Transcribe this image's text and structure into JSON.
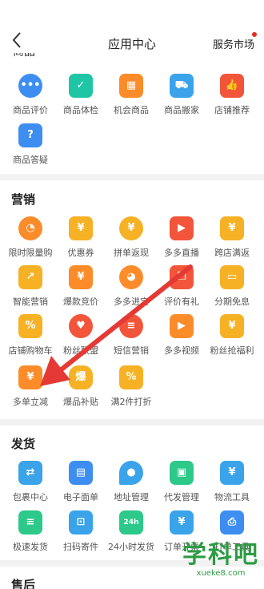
{
  "header": {
    "back_icon": "chevron-left-icon",
    "title": "应用中心",
    "market_label": "服务市场",
    "partial_title": "商品"
  },
  "colors": {
    "accent": "#e02e24",
    "arrow": "#e53935",
    "watermark": "#2d9b44"
  },
  "sections": {
    "goods": {
      "items": [
        {
          "label": "商品评价",
          "icon": "chat-bubble-icon"
        },
        {
          "label": "商品体检",
          "icon": "shopping-bag-check-icon"
        },
        {
          "label": "机会商品",
          "icon": "grid-search-icon"
        },
        {
          "label": "商品搬家",
          "icon": "truck-icon"
        },
        {
          "label": "店铺推荐",
          "icon": "thumbs-up-icon"
        },
        {
          "label": "商品答疑",
          "icon": "question-chat-icon"
        }
      ]
    },
    "marketing": {
      "title": "营销",
      "items": [
        {
          "label": "限时限量购",
          "icon": "clock-icon"
        },
        {
          "label": "优惠券",
          "icon": "coupon-icon"
        },
        {
          "label": "拼单返现",
          "icon": "coin-cycle-icon"
        },
        {
          "label": "多多直播",
          "icon": "video-play-icon"
        },
        {
          "label": "跨店满返",
          "icon": "house-yuan-icon"
        },
        {
          "label": "智能营销",
          "icon": "trend-chart-icon"
        },
        {
          "label": "爆款竞价",
          "icon": "gift-yuan-icon"
        },
        {
          "label": "多多进宝",
          "icon": "pig-icon"
        },
        {
          "label": "评价有礼",
          "icon": "gift-box-icon"
        },
        {
          "label": "分期免息",
          "icon": "credit-card-icon"
        },
        {
          "label": "店铺购物车",
          "icon": "cart-percent-icon"
        },
        {
          "label": "粉丝联盟",
          "icon": "heart-icon"
        },
        {
          "label": "短信营销",
          "icon": "message-icon"
        },
        {
          "label": "多多视频",
          "icon": "tv-icon"
        },
        {
          "label": "粉丝抢福利",
          "icon": "red-envelope-icon"
        },
        {
          "label": "多单立减",
          "icon": "stacked-discount-icon"
        },
        {
          "label": "爆品补贴",
          "icon": "money-bag-icon"
        },
        {
          "label": "满2件打折",
          "icon": "bag-percent-icon"
        }
      ]
    },
    "shipping": {
      "title": "发货",
      "items": [
        {
          "label": "包裹中心",
          "icon": "package-swap-icon"
        },
        {
          "label": "电子面单",
          "icon": "waybill-icon"
        },
        {
          "label": "地址管理",
          "icon": "location-pin-icon"
        },
        {
          "label": "代发管理",
          "icon": "box-icon"
        },
        {
          "label": "物流工具",
          "icon": "truck-yuan-icon"
        },
        {
          "label": "极速发货",
          "icon": "fast-list-icon"
        },
        {
          "label": "扫码寄件",
          "icon": "scan-box-icon"
        },
        {
          "label": "24小时发货",
          "icon": "24h-truck-icon"
        },
        {
          "label": "订单开票",
          "icon": "receipt-icon"
        },
        {
          "label": "打单工具",
          "icon": "printer-icon"
        }
      ]
    },
    "aftersale": {
      "title": "售后"
    }
  },
  "watermark": {
    "text": "学科吧",
    "url": "xueke8.com"
  }
}
